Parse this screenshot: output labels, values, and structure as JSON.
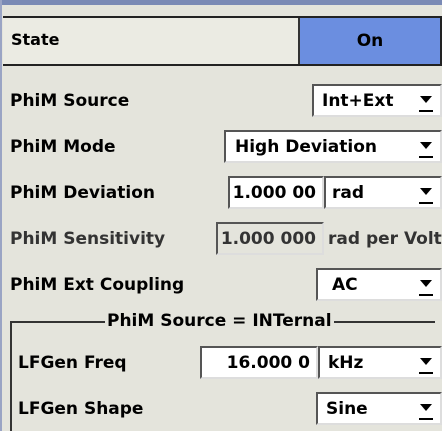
{
  "state": {
    "label": "State",
    "value": "On",
    "accent": "#6b8ee0"
  },
  "rows": {
    "source": {
      "label": "PhiM Source",
      "value": "Int+Ext"
    },
    "mode": {
      "label": "PhiM Mode",
      "value": "High Deviation"
    },
    "deviation": {
      "label": "PhiM Deviation",
      "value": "1.000 00",
      "unit": "rad"
    },
    "sensitivity": {
      "label": "PhiM Sensitivity",
      "value": "1.000 000",
      "unit": "rad per Volt"
    },
    "coupling": {
      "label": "PhiM Ext Coupling",
      "value": "AC"
    }
  },
  "group": {
    "title": "PhiM Source = INTernal",
    "lfgen_freq": {
      "label": "LFGen Freq",
      "value": "16.000 0",
      "unit": "kHz"
    },
    "lfgen_shape": {
      "label": "LFGen Shape",
      "value": "Sine"
    }
  },
  "icons": {
    "dropdown": "chevron-down-icon"
  }
}
